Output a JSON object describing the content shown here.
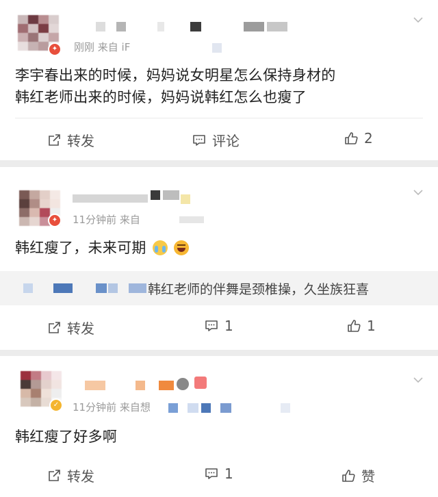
{
  "comments": [
    {
      "meta": "刚刚   来自 iF",
      "text_lines": [
        "李宇春出来的时候，妈妈说女明星怎么保持身材的",
        "韩红老师出来的时候，妈妈说韩红怎么也瘦了"
      ],
      "forward_label": "转发",
      "comment_label": "评论",
      "like_label": "2"
    },
    {
      "meta": "11分钟前   来自",
      "text": "韩红瘦了，未来可期",
      "reply_text": "韩红老师的伴舞是颈椎操，久坐族狂喜",
      "forward_label": "转发",
      "comment_label": "1",
      "like_label": "1"
    },
    {
      "meta": "11分钟前   来自想",
      "text": "韩红瘦了好多啊",
      "forward_label": "转发",
      "comment_label": "1",
      "like_label": "赞"
    }
  ],
  "icons": {
    "forward": "forward-icon",
    "comment": "comment-icon",
    "like": "thumbs-up-icon",
    "more": "chevron-down-icon",
    "verified": "verified-badge-icon"
  },
  "colors": {
    "meta_text": "#9a9a9a",
    "verified_red": "#e84f3c",
    "verified_gold": "#f4b52f"
  }
}
